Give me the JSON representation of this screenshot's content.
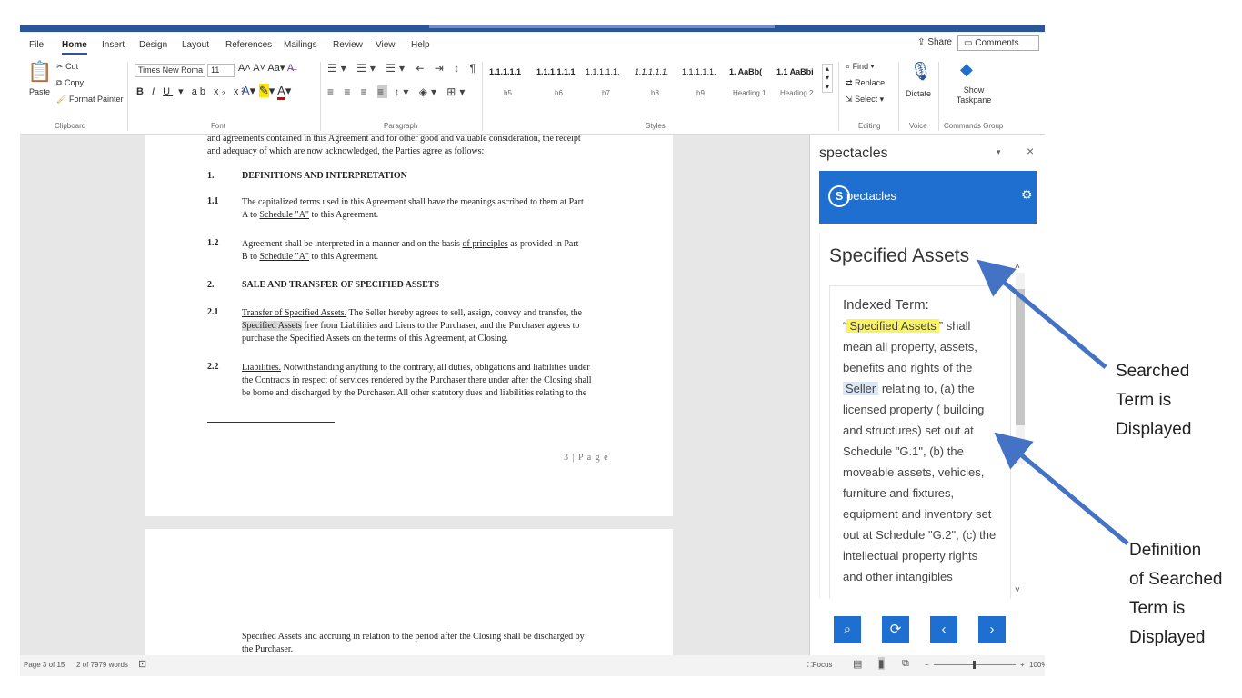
{
  "menu": {
    "items": [
      "File",
      "Home",
      "Insert",
      "Design",
      "Layout",
      "References",
      "Mailings",
      "Review",
      "View",
      "Help"
    ],
    "share": "Share",
    "comments": "Comments"
  },
  "ribbon": {
    "clipboard": {
      "paste": "Paste",
      "cut": "Cut",
      "copy": "Copy",
      "format_painter": "Format Painter",
      "label": "Clipboard"
    },
    "font": {
      "name": "Times New Roma",
      "size": "11",
      "label": "Font"
    },
    "paragraph_label": "Paragraph",
    "styles": {
      "label": "Styles",
      "items": [
        {
          "preview": "1.1.1.1.1",
          "name": "h5"
        },
        {
          "preview": "1.1.1.1.1.1",
          "name": "h6"
        },
        {
          "preview": "1.1.1.1.1.",
          "name": "h7"
        },
        {
          "preview": "1.1.1.1.1.",
          "name": "h8"
        },
        {
          "preview": "1.1.1.1.1.",
          "name": "h9"
        },
        {
          "preview": "1. AaBb(",
          "name": "Heading 1"
        },
        {
          "preview": "1.1 AaBbi",
          "name": "Heading 2"
        }
      ]
    },
    "editing": {
      "find": "Find",
      "replace": "Replace",
      "select": "Select",
      "label": "Editing"
    },
    "voice": {
      "dictate": "Dictate",
      "label": "Voice"
    },
    "commands": {
      "show_taskpane": "Show Taskpane",
      "label": "Commands Group"
    }
  },
  "document": {
    "intro_line1": "and agreements contained in this Agreement and for other good and valuable consideration, the receipt",
    "intro_line2": "and adequacy of which are now acknowledged, the Parties agree as follows:",
    "s1_num": "1.",
    "s1_title": "DEFINITIONS AND INTERPRETATION",
    "s11_num": "1.1",
    "s11_text_a": "The capitalized terms used in this Agreement shall have the meanings ascribed to them at Part",
    "s11_text_b": "A to ",
    "s11_link": "Schedule \"A\"",
    "s11_text_c": " to this Agreement.",
    "s12_num": "1.2",
    "s12_text_a": "Agreement shall be interpreted in a manner and on the basis ",
    "s12_link_a": "of principles",
    "s12_text_b": " as provided in Part",
    "s12_text_c": "B to ",
    "s12_link_b": "Schedule \"A\"",
    "s12_text_d": " to this Agreement.",
    "s2_num": "2.",
    "s2_title": "SALE AND TRANSFER OF SPECIFIED ASSETS",
    "s21_num": "2.1",
    "s21_link": "Transfer of Specified Assets.",
    "s21_text_a": " The Seller hereby agrees to sell, assign, convey and transfer, the",
    "s21_hi": "Specified Assets",
    "s21_text_b": " free from Liabilities and Liens to the Purchaser, and the Purchaser agrees to",
    "s21_text_c": "purchase the Specified Assets on the terms of this Agreement, at Closing.",
    "s22_num": "2.2",
    "s22_link": "Liabilities.",
    "s22_text_a": " Notwithstanding anything to the contrary, all duties, obligations and liabilities under",
    "s22_text_b": "the Contracts in respect of services rendered by the Purchaser there under after the Closing shall",
    "s22_text_c": "be borne and discharged by the Purchaser. All other statutory dues and liabilities relating to the",
    "page_number": "3 | P a g e",
    "page2_line1": "Specified Assets and accruing in relation to the period after the Closing shall be discharged by",
    "page2_line2": "the Purchaser."
  },
  "pane": {
    "title": "spectacles",
    "logo_letter": "S",
    "logo_text": "pectacles",
    "result_title": "Specified Assets",
    "indexed_label": "Indexed Term:",
    "term_highlight": "Specified Assets",
    "def_a": " shall mean all property, assets, benefits and rights of the ",
    "term_seller": "Seller",
    "def_b": " relating to, (a) the licensed property ( building and structures) set out at Schedule \"G.1\", (b) the moveable assets, vehicles, furniture and fixtures, equipment and inventory set out at Schedule \"G.2\", (c) the intellectual property rights and other intangibles"
  },
  "status": {
    "page": "Page 3 of 15",
    "words": "2 of 7979 words",
    "focus": "Focus",
    "zoom": "100%"
  },
  "annotations": {
    "searched": [
      "Searched",
      "Term is",
      "Displayed"
    ],
    "definition": [
      "Definition",
      "of Searched",
      "Term is",
      "Displayed"
    ]
  },
  "colors": {
    "word_blue": "#2b579a",
    "pane_blue": "#1e6fcf",
    "highlight_yellow": "#fbf35d",
    "arrow_blue": "#4472c4"
  }
}
